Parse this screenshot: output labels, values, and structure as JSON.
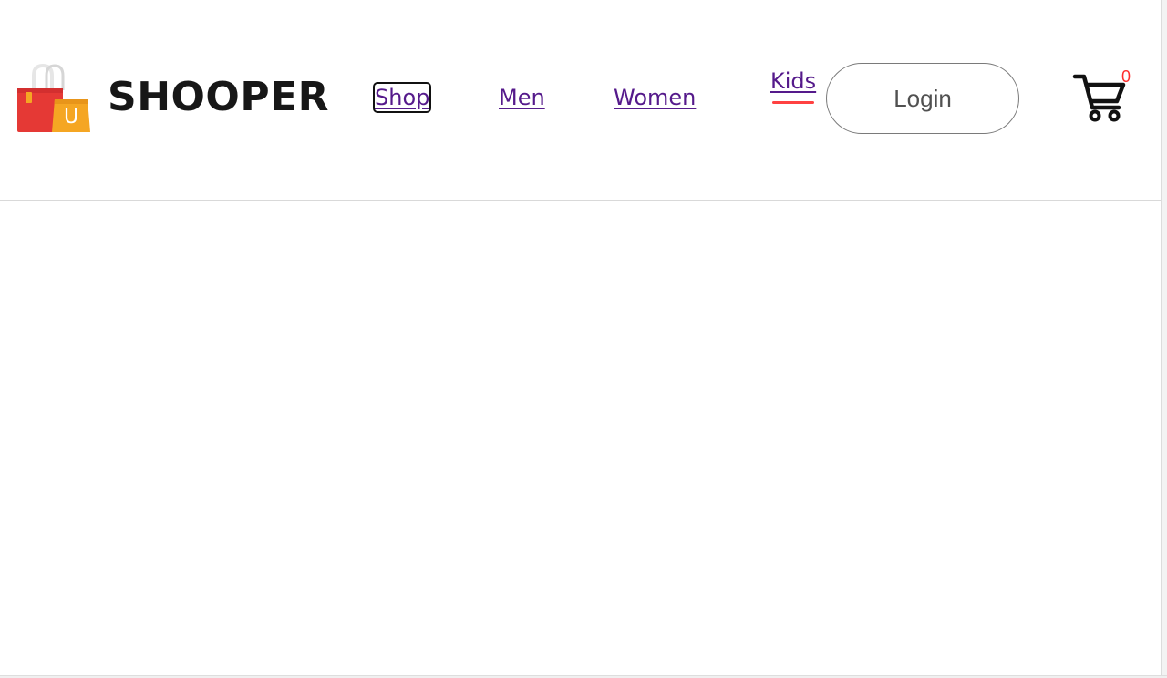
{
  "brand": {
    "name": "SHOOPER",
    "logo_letter": "U"
  },
  "nav": {
    "items": [
      {
        "label": "Shop",
        "focused": true
      },
      {
        "label": "Men"
      },
      {
        "label": "Women"
      },
      {
        "label": "Kids",
        "active": true
      }
    ]
  },
  "login": {
    "label": "Login"
  },
  "cart": {
    "count": "0"
  },
  "colors": {
    "link": "#551a8b",
    "accent": "#ff4141",
    "bag_red": "#e53935",
    "bag_yellow": "#f5a623"
  },
  "icons": {
    "logo": "shopping-bag-icon",
    "cart": "shopping-cart-icon"
  }
}
